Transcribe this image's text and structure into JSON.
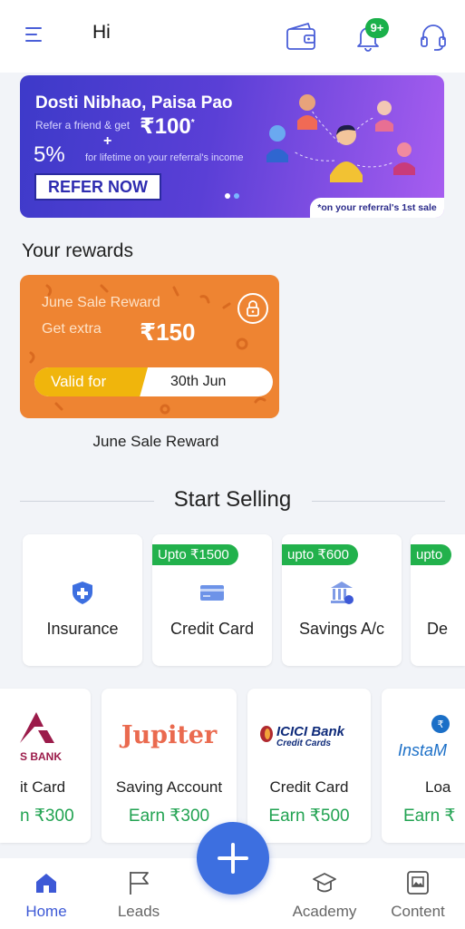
{
  "header": {
    "greeting": "Hi",
    "notification_badge": "9+",
    "icons": [
      "menu-icon",
      "wallet-icon",
      "bell-icon",
      "headset-icon"
    ]
  },
  "banner": {
    "title": "Dosti Nibhao, Paisa Pao",
    "refer_text": "Refer a friend & get",
    "refer_amount": "₹100",
    "refer_amount_mark": "*",
    "plus": "+",
    "percent": "5%",
    "percent_text": "for lifetime on your referral's income",
    "cta": "REFER NOW",
    "footnote": "*on your referral's 1st sale",
    "colors": {
      "start": "#3d3ac9",
      "end": "#a85ef0"
    }
  },
  "rewards": {
    "heading": "Your rewards",
    "card": {
      "title": "June Sale Reward",
      "extra_label": "Get extra",
      "amount": "₹150",
      "valid_label": "Valid for",
      "valid_date": "30th Jun",
      "caption": "June Sale Reward",
      "color": "#ee8432"
    }
  },
  "start_selling": {
    "heading": "Start Selling",
    "categories": [
      {
        "label": "Insurance",
        "tag": "",
        "icon": "shield-plus-icon"
      },
      {
        "label": "Credit Card",
        "tag": "Upto ₹1500",
        "icon": "credit-card-icon"
      },
      {
        "label": "Savings A/c",
        "tag": "upto ₹600",
        "icon": "bank-icon"
      },
      {
        "label": "De",
        "tag": "upto",
        "icon": ""
      }
    ],
    "products": [
      {
        "brand": "S BANK",
        "name": "it Card",
        "earn": "n ₹300"
      },
      {
        "brand": "Jupiter",
        "name": "Saving Account",
        "earn": "Earn ₹300"
      },
      {
        "brand": "ICICI Bank",
        "brand_sub": "Credit Cards",
        "name": "Credit Card",
        "earn": "Earn ₹500"
      },
      {
        "brand": "InstaM",
        "name": "Loa",
        "earn": "Earn ₹"
      }
    ]
  },
  "bottom_nav": {
    "items": [
      {
        "label": "Home",
        "icon": "home-icon",
        "active": true
      },
      {
        "label": "Leads",
        "icon": "flag-icon",
        "active": false
      },
      {
        "label": "Academy",
        "icon": "graduation-cap-icon",
        "active": false
      },
      {
        "label": "Content",
        "icon": "image-icon",
        "active": false
      }
    ],
    "fab_icon": "plus-icon",
    "active_color": "#3d59d6"
  }
}
